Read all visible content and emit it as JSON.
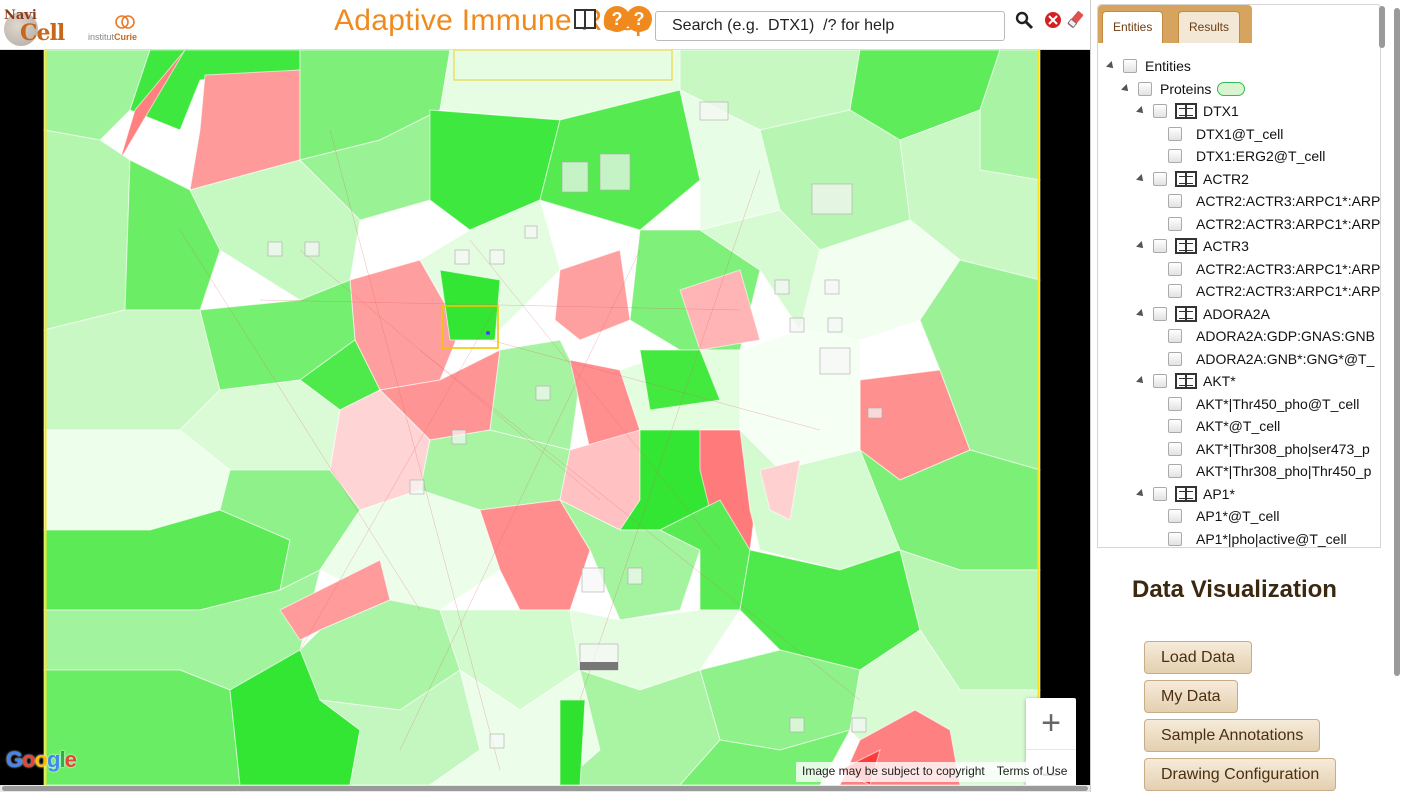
{
  "header": {
    "title": "Adaptive Immune Resp",
    "logo": {
      "navi_text": "Navi",
      "cell_text": "Cell",
      "institute_prefix": "institut",
      "institute_name": "Curie"
    },
    "help_text": "?",
    "search": {
      "placeholder": "Search (e.g.  DTX1)  /? for help"
    },
    "icons": [
      "book-icon",
      "search-icon",
      "close-icon",
      "eraser-icon"
    ]
  },
  "map": {
    "zoom_in_label": "+",
    "zoom_out_label": "−",
    "google_logo": "Google",
    "attribution": {
      "copyright": "Image may be subject to copyright",
      "terms": "Terms of Use"
    },
    "colors": {
      "up": "#33e633",
      "down": "#ff7a7a",
      "neutral": "#ffffff",
      "border": "#ffe31a"
    }
  },
  "panel": {
    "tabs": [
      {
        "label": "Entities"
      },
      {
        "label": "Results"
      }
    ],
    "tree": [
      {
        "label": "Entities",
        "level": 0,
        "toggle": true
      },
      {
        "label": "Proteins",
        "level": 1,
        "toggle": true,
        "pill": true
      },
      {
        "label": "DTX1",
        "level": 2,
        "toggle": true,
        "book": true
      },
      {
        "label": "DTX1@T_cell",
        "level": 3
      },
      {
        "label": "DTX1:ERG2@T_cell",
        "level": 3
      },
      {
        "label": "ACTR2",
        "level": 2,
        "toggle": true,
        "book": true
      },
      {
        "label": "ACTR2:ACTR3:ARPC1*:ARP",
        "level": 3
      },
      {
        "label": "ACTR2:ACTR3:ARPC1*:ARP",
        "level": 3
      },
      {
        "label": "ACTR3",
        "level": 2,
        "toggle": true,
        "book": true
      },
      {
        "label": "ACTR2:ACTR3:ARPC1*:ARP",
        "level": 3
      },
      {
        "label": "ACTR2:ACTR3:ARPC1*:ARP",
        "level": 3
      },
      {
        "label": "ADORA2A",
        "level": 2,
        "toggle": true,
        "book": true
      },
      {
        "label": "ADORA2A:GDP:GNAS:GNB",
        "level": 3
      },
      {
        "label": "ADORA2A:GNB*:GNG*@T_",
        "level": 3
      },
      {
        "label": "AKT*",
        "level": 2,
        "toggle": true,
        "book": true
      },
      {
        "label": "AKT*|Thr450_pho@T_cell",
        "level": 3
      },
      {
        "label": "AKT*@T_cell",
        "level": 3
      },
      {
        "label": "AKT*|Thr308_pho|ser473_p",
        "level": 3
      },
      {
        "label": "AKT*|Thr308_pho|Thr450_p",
        "level": 3
      },
      {
        "label": "AP1*",
        "level": 2,
        "toggle": true,
        "book": true
      },
      {
        "label": "AP1*@T_cell",
        "level": 3
      },
      {
        "label": "AP1*|pho|active@T_cell",
        "level": 3
      }
    ],
    "data_visualization": {
      "title": "Data Visualization",
      "buttons": [
        {
          "label": "Load Data"
        },
        {
          "label": "My Data"
        },
        {
          "label": "Sample Annotations"
        },
        {
          "label": "Drawing Configuration"
        }
      ]
    }
  }
}
